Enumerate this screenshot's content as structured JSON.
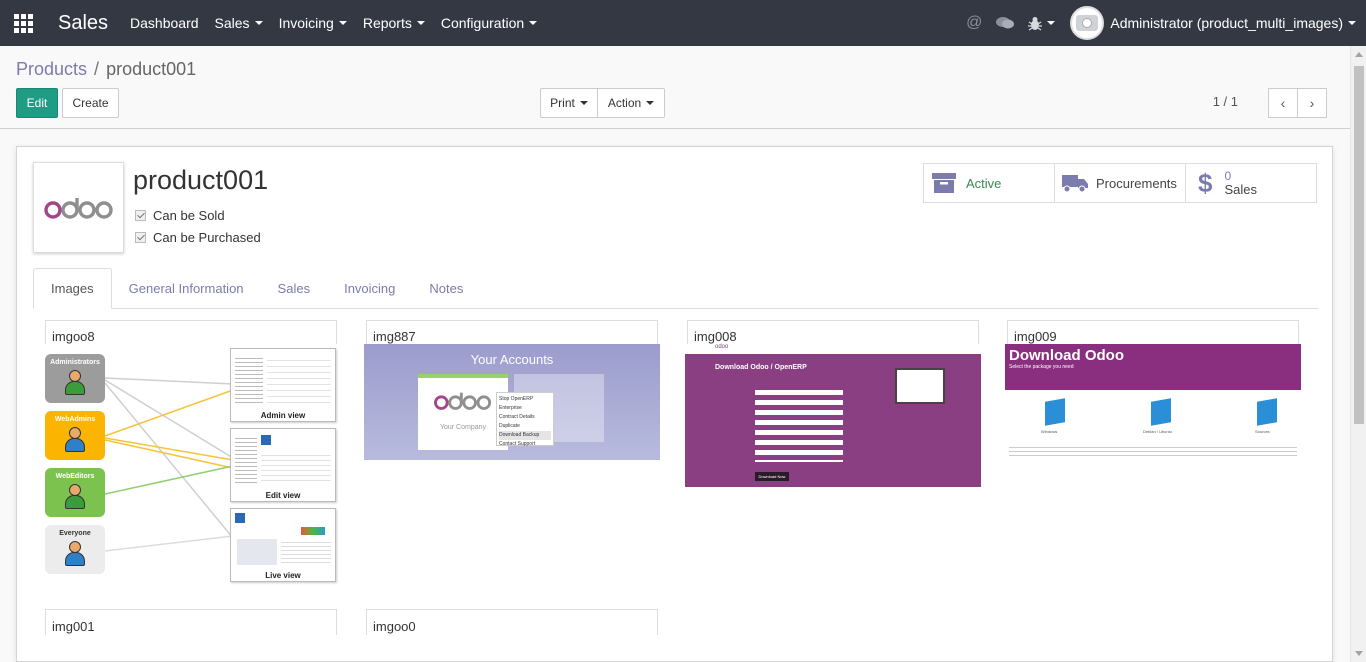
{
  "navbar": {
    "brand": "Sales",
    "menu": [
      {
        "label": "Dashboard",
        "dropdown": false
      },
      {
        "label": "Sales",
        "dropdown": true
      },
      {
        "label": "Invoicing",
        "dropdown": true
      },
      {
        "label": "Reports",
        "dropdown": true
      },
      {
        "label": "Configuration",
        "dropdown": true
      }
    ],
    "user": "Administrator (product_multi_images)",
    "icons": [
      "apps-grid-icon",
      "at-icon",
      "chat-icon",
      "bug-icon",
      "camera-icon"
    ]
  },
  "breadcrumb": {
    "parent": "Products",
    "separator": "/",
    "current": "product001"
  },
  "buttons": {
    "edit": "Edit",
    "create": "Create",
    "print": "Print",
    "action": "Action"
  },
  "pager": {
    "value": "1 / 1"
  },
  "product": {
    "name": "product001",
    "logo_text": "odoo",
    "can_be_sold": "Can be Sold",
    "can_be_purchased": "Can be Purchased"
  },
  "stat_buttons": {
    "active": "Active",
    "procurements": "Procurements",
    "sales_count": "0",
    "sales_label": "Sales"
  },
  "tabs": [
    "Images",
    "General Information",
    "Sales",
    "Invoicing",
    "Notes"
  ],
  "images": [
    {
      "title": "imgoo8"
    },
    {
      "title": "img887"
    },
    {
      "title": "img008"
    },
    {
      "title": "img009"
    },
    {
      "title": "img001"
    },
    {
      "title": "imgoo0"
    }
  ],
  "img_content": {
    "roles": [
      "Administrators",
      "WebAdmins",
      "WebEditors",
      "Everyone"
    ],
    "shots": [
      "Admin view",
      "Edit view",
      "Live view"
    ],
    "accounts_title": "Your Accounts",
    "accounts_company": "Your Company",
    "accounts_menu": [
      "Stop OpenERP",
      "Enterprise",
      "Contract Details",
      "Duplicate",
      "Download Backup",
      "Contact Support"
    ],
    "download_header": "Download Odoo / OpenERP",
    "download_button": "Download Now",
    "download_odoo_title": "Download Odoo",
    "download_odoo_sub": "Select the package you need",
    "download_platforms": [
      "Windows",
      "Debian / Ubuntu",
      "Sources"
    ]
  },
  "colors": {
    "navbar": "#333843",
    "primary": "#1f9d84",
    "link": "#7c7bad",
    "download_purple": "#8a2f7f"
  }
}
